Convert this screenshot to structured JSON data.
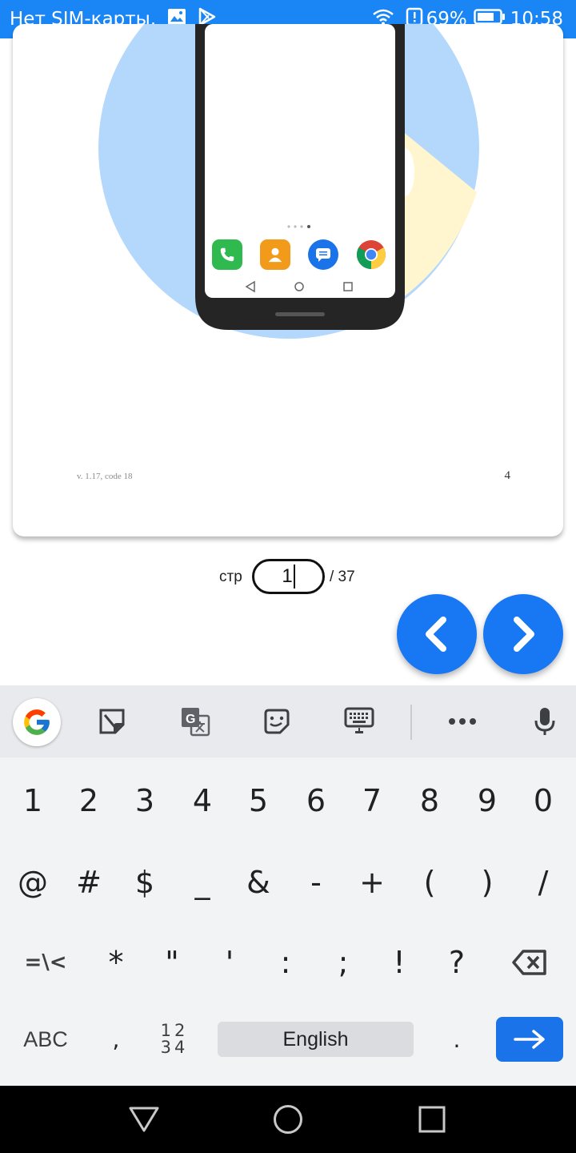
{
  "status_bar": {
    "carrier": "Нет SIM-карты.",
    "battery": "69%",
    "time": "10:58",
    "icons": [
      "gallery-icon",
      "play-store-icon",
      "wifi-icon",
      "battery-alert-icon",
      "battery-icon"
    ]
  },
  "document": {
    "version_text": "v. 1.17, code 18",
    "page_number": "4",
    "illustration": {
      "phone_dock_icons": [
        "phone-icon",
        "contacts-icon",
        "messages-icon",
        "chrome-icon"
      ],
      "colors": {
        "circle_blue": "#b3d8fb",
        "circle_yellow": "#fff5cf",
        "phone_body": "#252525"
      }
    }
  },
  "pager": {
    "label": "стр",
    "current": "1",
    "total": "/ 37",
    "prev_icon": "chevron-left-icon",
    "next_icon": "chevron-right-icon"
  },
  "keyboard": {
    "toolbar": [
      "google-icon",
      "sticker-icon",
      "translate-icon",
      "emoji-icon",
      "keyboard-layout-icon",
      "more-icon",
      "mic-icon"
    ],
    "rows": [
      [
        "1",
        "2",
        "3",
        "4",
        "5",
        "6",
        "7",
        "8",
        "9",
        "0"
      ],
      [
        "@",
        "#",
        "$",
        "_",
        "&",
        "-",
        "+",
        "(",
        ")",
        "/"
      ],
      [
        "=\\<",
        "*",
        "\"",
        "'",
        ":",
        ";",
        "!",
        "?"
      ]
    ],
    "bottom": {
      "abc": "ABC",
      "comma": ",",
      "num": "12\n34",
      "space": "English",
      "period": "."
    }
  },
  "colors": {
    "accent": "#1877f2",
    "status_bar": "#1a86f5",
    "enter_key": "#1a73e8"
  }
}
